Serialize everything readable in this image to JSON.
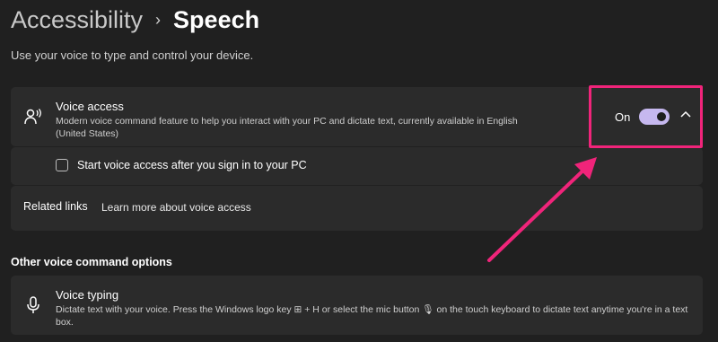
{
  "breadcrumb": {
    "parent": "Accessibility",
    "separator": "›",
    "current": "Speech"
  },
  "description": "Use your voice to type and control your device.",
  "voice_access": {
    "icon": "voice-access-icon",
    "title": "Voice access",
    "description": "Modern voice command feature to help you interact with your PC and dictate text, currently available in English (United States)",
    "toggle_label": "On",
    "toggle_on": true,
    "expanded": true,
    "accent_color": "#c6b8ef"
  },
  "start_option": {
    "label": "Start voice access after you sign in to your PC",
    "checked": false
  },
  "related": {
    "label": "Related links",
    "link": "Learn more about voice access"
  },
  "other_options": {
    "heading": "Other voice command options"
  },
  "voice_typing": {
    "icon": "microphone-icon",
    "title": "Voice typing",
    "description": "Dictate text with your voice. Press the Windows logo key ⊞ + H or select the mic button 🎙 on the touch keyboard to dictate text anytime you're in a text box."
  },
  "annotation": {
    "highlight_color": "#f0247a"
  }
}
